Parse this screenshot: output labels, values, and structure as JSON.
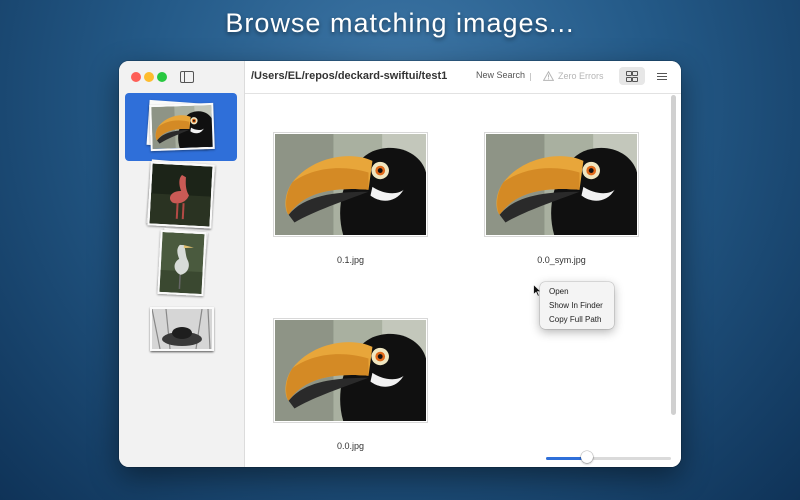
{
  "banner": {
    "headline": "Browse matching images..."
  },
  "window": {
    "path": "/Users/EL/repos/deckard-swiftui/test1",
    "toolbar": {
      "new_search_label": "New Search",
      "zero_errors_label": "Zero Errors",
      "warning_icon": "warning-triangle-icon",
      "grid_view_icon": "grid-view-icon",
      "list_view_icon": "list-view-icon"
    },
    "sidebar": {
      "toggle_icon": "sidebar-toggle-icon",
      "groups": [
        {
          "subject": "toucan",
          "selected": true
        },
        {
          "subject": "flamingo",
          "selected": false
        },
        {
          "subject": "heron",
          "selected": false
        },
        {
          "subject": "bird-on-nest",
          "selected": false
        }
      ]
    },
    "grid": {
      "images": [
        {
          "caption": "0.1.jpg"
        },
        {
          "caption": "0.0_sym.jpg"
        },
        {
          "caption": "0.0.jpg"
        }
      ]
    },
    "context_menu": {
      "items": [
        {
          "label": "Open"
        },
        {
          "label": "Show In Finder"
        },
        {
          "label": "Copy Full Path"
        }
      ]
    },
    "zoom_slider": {
      "value": 0.32
    }
  },
  "colors": {
    "accent": "#2f6fd9",
    "close": "#fe5f57",
    "minimize": "#febc2e",
    "maximize": "#28c840"
  }
}
